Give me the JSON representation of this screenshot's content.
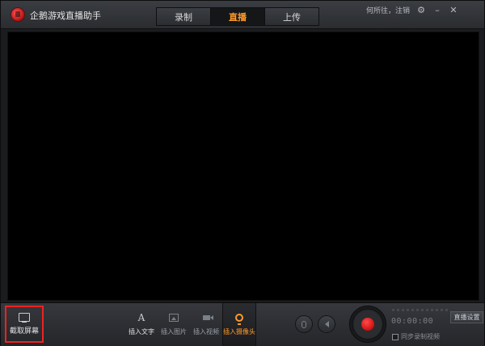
{
  "app": {
    "title": "企鹅游戏直播助手"
  },
  "tabs": [
    {
      "label": "录制",
      "active": false
    },
    {
      "label": "直播",
      "active": true
    },
    {
      "label": "上传",
      "active": false
    }
  ],
  "user": {
    "name": "何所往",
    "separator": "，",
    "logout": "注销"
  },
  "window_icons": {
    "settings": "gear-icon",
    "minimize": "minimize-icon",
    "close": "close-icon"
  },
  "toolbar": {
    "capture_label": "截取屏幕",
    "insert_items": [
      {
        "label": "插入文字",
        "icon": "text-icon",
        "glyph": "A"
      },
      {
        "label": "插入图片",
        "icon": "image-icon"
      },
      {
        "label": "插入视频",
        "icon": "video-icon"
      },
      {
        "label": "插入摄像头",
        "icon": "camera-icon",
        "active": true
      }
    ],
    "timer": "00:00:00",
    "sync_label": "同步录制视频",
    "settings_label": "直播设置"
  },
  "colors": {
    "accent": "#ff9a2a",
    "record": "#e01818",
    "highlight_border": "#e22222",
    "background": "#1b1c1f"
  }
}
